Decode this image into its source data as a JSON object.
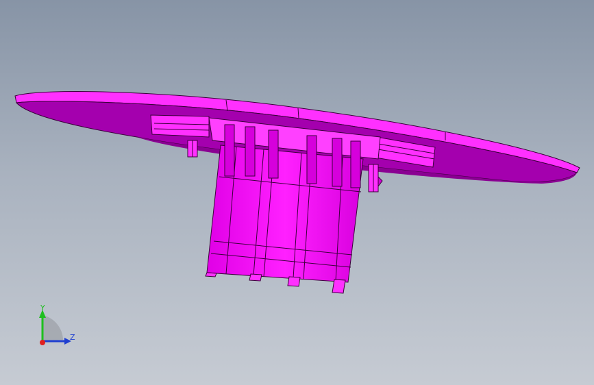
{
  "viewport": {
    "background_top": "#8794a6",
    "background_bottom": "#c6cbd3"
  },
  "model": {
    "part_color": "#ff00ff",
    "shade_dark": "#a000a8",
    "shade_mid": "#d400d8",
    "edge_color": "#3a003a"
  },
  "triad": {
    "y_label": "Y",
    "z_label": "Z",
    "y_color": "#1fbf1f",
    "z_color": "#1f3fd0",
    "x_color": "#e02020"
  }
}
